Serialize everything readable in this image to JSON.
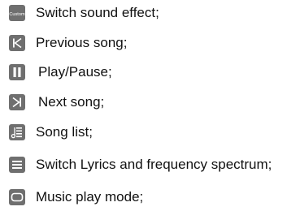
{
  "legend": {
    "items": [
      {
        "icon": "custom-sound-icon",
        "icon_text": "Custom",
        "label": "Switch sound effect;"
      },
      {
        "icon": "previous-song-icon",
        "label": "Previous song;"
      },
      {
        "icon": "play-pause-icon",
        "label": "Play/Pause;"
      },
      {
        "icon": "next-song-icon",
        "label": "Next song;"
      },
      {
        "icon": "song-list-icon",
        "label": "Song list;"
      },
      {
        "icon": "lyrics-spectrum-icon",
        "label": "Switch Lyrics and frequency spectrum;"
      },
      {
        "icon": "play-mode-icon",
        "label": "Music play mode;"
      }
    ]
  },
  "colors": {
    "icon_fill": "#6f6f6f",
    "icon_glyph": "#ffffff",
    "text": "#111111"
  }
}
